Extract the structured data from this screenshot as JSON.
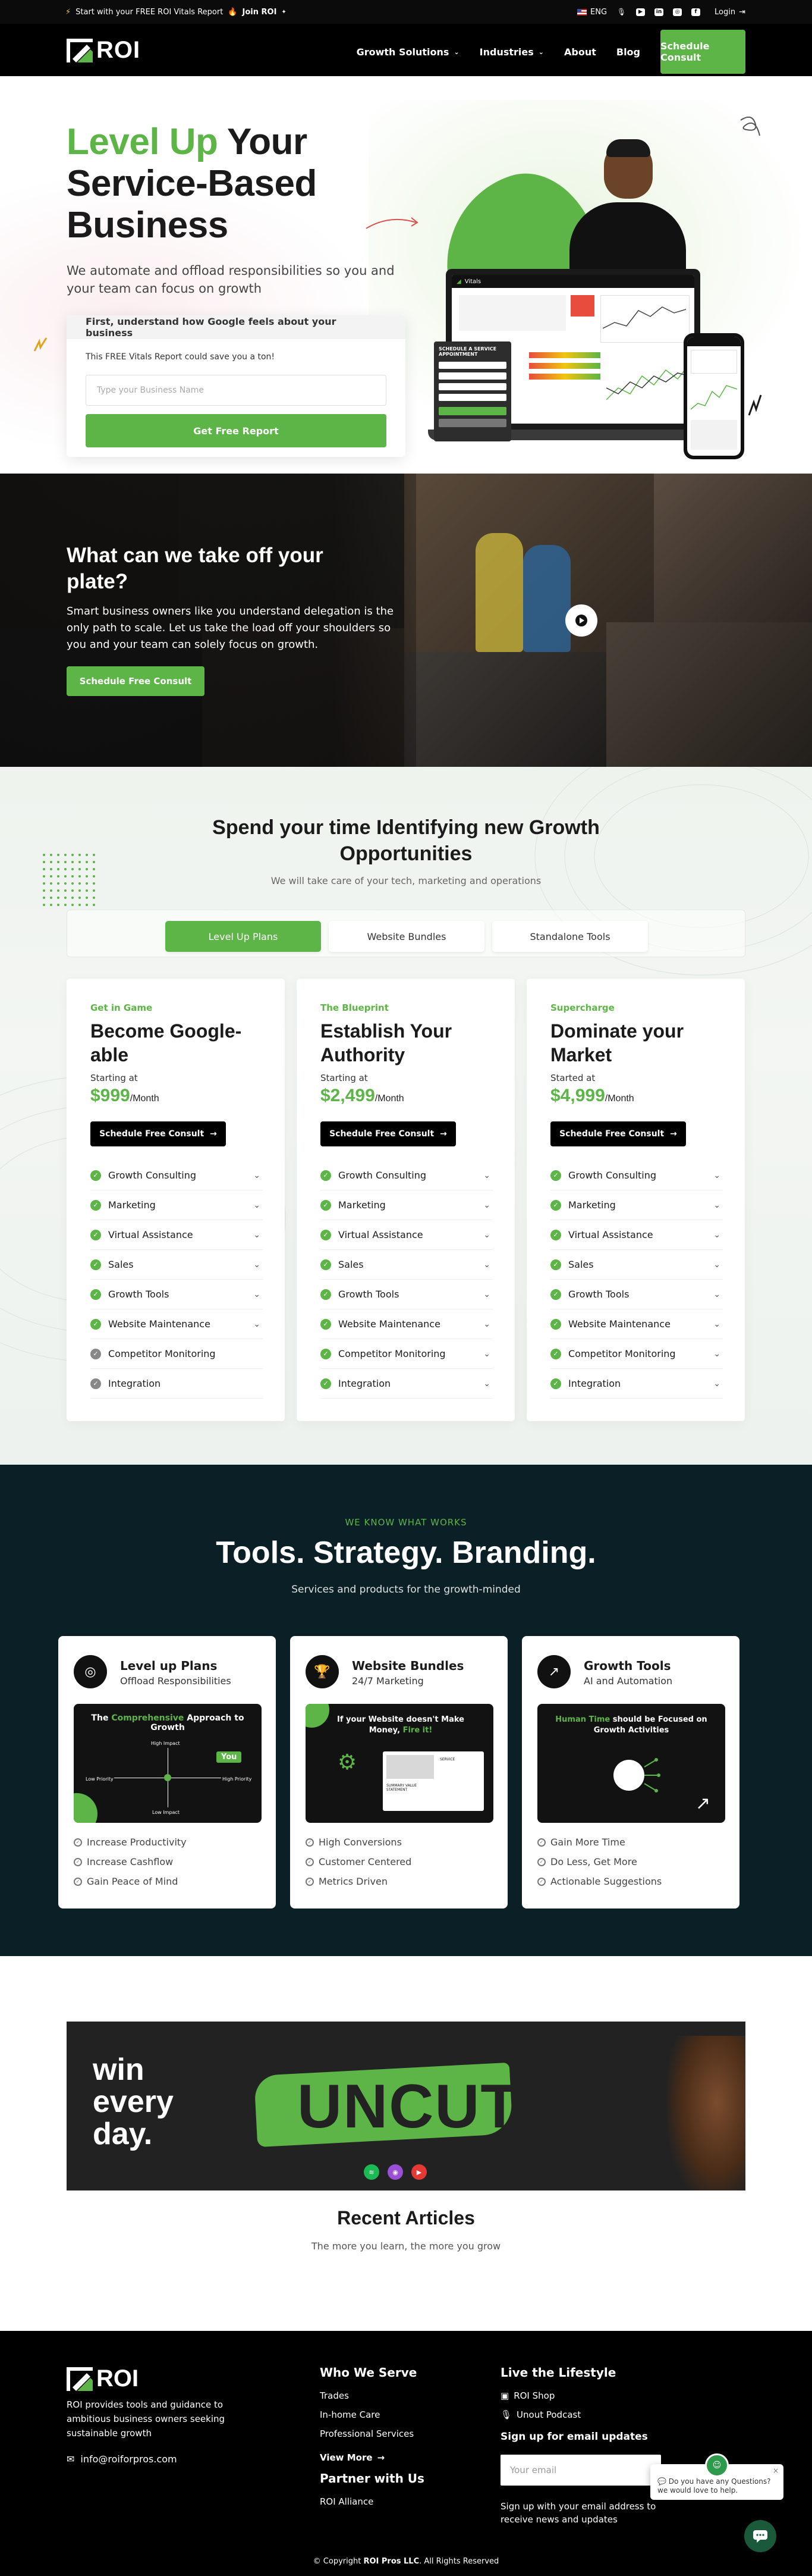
{
  "topbar": {
    "promo_text": "Start with your FREE ROI Vitals Report",
    "promo_link": "Join ROI",
    "language": "ENG",
    "login": "Login"
  },
  "nav": {
    "logo_text": "ROI",
    "items": [
      "Growth Solutions",
      "Industries",
      "About",
      "Blog"
    ],
    "cta": "Schedule Consult"
  },
  "hero": {
    "title_green": "Level Up",
    "title_rest": " Your Service-Based Business",
    "subtitle": "We automate and offload responsibilities so you and your team can focus on growth",
    "form_header": "First, understand how Google feels about your business",
    "form_note": "This FREE Vitals Report could save you a ton!",
    "input_placeholder": "Type your Business Name",
    "submit_label": "Get Free Report",
    "mock": {
      "app_title": "Vitals",
      "schedule_title": "SCHEDULE A SERVICE APPOINTMENT"
    }
  },
  "plate": {
    "title": "What can we take off your plate?",
    "body": "Smart business owners like you understand delegation is the only path to scale. Let us take the load off your shoulders so you and your team can solely focus on growth.",
    "cta": "Schedule Free Consult"
  },
  "spend": {
    "title": "Spend your time Identifying new Growth Opportunities",
    "subtitle": "We will take care of your tech, marketing and operations",
    "tabs": [
      "Level Up Plans",
      "Website Bundles",
      "Standalone Tools"
    ],
    "active_tab": "Level Up Plans",
    "plans": [
      {
        "kicker": "Get in Game",
        "title": "Become Google-able",
        "from": "Starting at",
        "price": "$999",
        "per": "/Month",
        "cta": "Schedule Free Consult",
        "features": [
          "Growth Consulting",
          "Marketing",
          "Virtual Assistance",
          "Sales",
          "Growth Tools",
          "Website Maintenance",
          "Competitor Monitoring",
          "Integration"
        ]
      },
      {
        "kicker": "The Blueprint",
        "title": "Establish Your Authority",
        "from": "Starting at",
        "price": "$2,499",
        "per": "/Month",
        "cta": "Schedule Free Consult",
        "features": [
          "Growth Consulting",
          "Marketing",
          "Virtual Assistance",
          "Sales",
          "Growth Tools",
          "Website Maintenance",
          "Competitor Monitoring",
          "Integration"
        ]
      },
      {
        "kicker": "Supercharge",
        "title": "Dominate your Market",
        "from": "Started at",
        "price": "$4,999",
        "per": "/Month",
        "cta": "Schedule Free Consult",
        "features": [
          "Growth Consulting",
          "Marketing",
          "Virtual Assistance",
          "Sales",
          "Growth Tools",
          "Website Maintenance",
          "Competitor Monitoring",
          "Integration"
        ]
      }
    ]
  },
  "tools": {
    "kicker": "WE KNOW WHAT WORKS",
    "title": "Tools. Strategy. Branding.",
    "subtitle": "Services and products for the growth-minded",
    "cards": [
      {
        "title": "Level up Plans",
        "subtitle": "Offload Responsibilities",
        "panel_pre": "The ",
        "panel_hi": "Comprehensive",
        "panel_post": " Approach to Growth",
        "panel_labels": [
          "High Impact",
          "Low Impact",
          "Low Priority",
          "High Priority",
          "You"
        ],
        "points": [
          "Increase Productivity",
          "Increase Cashflow",
          "Gain Peace of Mind"
        ]
      },
      {
        "title": "Website Bundles",
        "subtitle": "24/7 Marketing",
        "panel_pre": "If your Website doesn't Make Money, ",
        "panel_hi": "Fire it!",
        "panel_post": "",
        "panel_labels": [
          "SUMMARY VALUE STATEMENT",
          "SERVICE"
        ],
        "points": [
          "High Conversions",
          "Customer Centered",
          "Metrics Driven"
        ]
      },
      {
        "title": "Growth Tools",
        "subtitle": "AI and Automation",
        "panel_pre": "",
        "panel_hi": "Human Time",
        "panel_post": " should be Focused on Growth Activities",
        "panel_labels": [],
        "points": [
          "Gain More Time",
          "Do Less, Get More",
          "Actionable Suggestions"
        ]
      }
    ]
  },
  "uncut": {
    "tagline": [
      "win",
      "every",
      "day."
    ],
    "word": "UNCUT",
    "title": "Recent Articles",
    "subtitle": "The more you learn, the more you grow"
  },
  "footer": {
    "logo_text": "ROI",
    "description": "ROI provides tools and guidance to ambitious business owners seeking sustainable growth",
    "email": "info@roiforpros.com",
    "who_title": "Who We Serve",
    "who_items": [
      "Trades",
      "In-home Care",
      "Professional Services",
      "View More"
    ],
    "partner_title": "Partner with Us",
    "partner_items": [
      "ROI Alliance"
    ],
    "live_title": "Live the Lifestyle",
    "live_items": [
      "ROI Shop",
      "Unout Podcast"
    ],
    "signup_title": "Sign up for email updates",
    "email_placeholder": "Your email",
    "signup_note": "Sign up with your email address to receive news and updates",
    "copyright_pre": "© Copyright ",
    "copyright_brand": "ROI Pros LLC",
    "copyright_post": ". All Rights Reserved",
    "chat_text": "Do you have any Questions? we would love to help."
  },
  "colors": {
    "accent": "#5cb546",
    "dark": "#0b1f27",
    "black": "#000000"
  }
}
